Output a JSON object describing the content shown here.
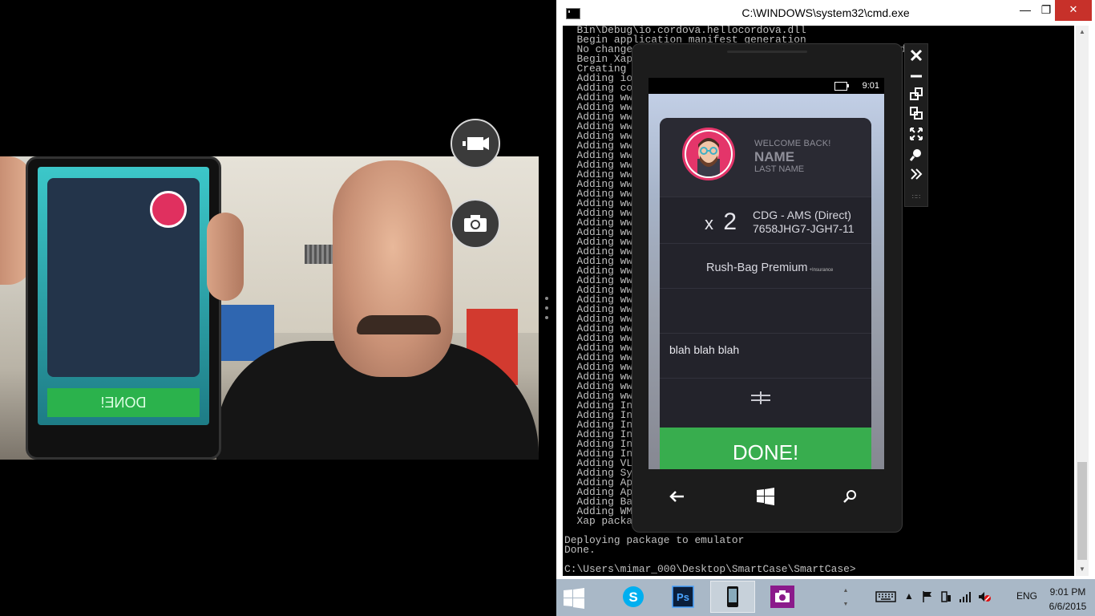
{
  "console": {
    "title": "C:\\WINDOWS\\system32\\cmd.exe",
    "minimize": "—",
    "maximize": "❐",
    "close": "✕",
    "lines": [
      "  Bin\\Debug\\io.cordova.hellocordova.dll",
      "  Begin application manifest generation",
      "  No change                                        to date",
      "  Begin Xap",
      "  Creating",
      "  Adding io",
      "  Adding co",
      "  Adding ww",
      "  Adding ww",
      "  Adding ww",
      "  Adding ww",
      "  Adding ww",
      "  Adding ww",
      "  Adding ww",
      "  Adding ww",
      "  Adding ww",
      "  Adding ww",
      "  Adding ww",
      "  Adding ww",
      "  Adding ww",
      "  Adding ww",
      "  Adding ww",
      "  Adding ww",
      "  Adding ww",
      "  Adding ww",
      "  Adding ww",
      "  Adding ww",
      "  Adding ww",
      "  Adding ww",
      "  Adding ww",
      "  Adding ww",
      "  Adding ww",
      "  Adding ww",
      "  Adding ww",
      "  Adding ww",
      "  Adding ww",
      "  Adding ww",
      "  Adding ww",
      "  Adding ww",
      "  Adding In",
      "  Adding In",
      "  Adding In",
      "  Adding In",
      "  Adding In",
      "  Adding In",
      "  Adding VL",
      "  Adding Sy",
      "  Adding Ap",
      "  Adding Ap",
      "  Adding Ba",
      "  Adding WM",
      "  Xap packa",
      "",
      "Deploying package to emulator",
      "Done.",
      "",
      "C:\\Users\\mimar_000\\Desktop\\SmartCase\\SmartCase>"
    ]
  },
  "camera": {
    "video_button": "video-mode",
    "photo_button": "photo-mode",
    "photo_phone_done": "DONE!"
  },
  "emulator": {
    "status_time": "9:01",
    "profile": {
      "welcome": "WELCOME BACK!",
      "name": "NAME",
      "last_name": "LAST NAME"
    },
    "bag": {
      "multiplier": "x",
      "count": "2",
      "route": "CDG - AMS (Direct)",
      "reference": "7658JHG7-JGH7-11"
    },
    "insurance": {
      "label": "Rush-Bag Premium",
      "suffix": "+Insurance"
    },
    "note": "blah blah blah",
    "done_label": "DONE!",
    "toolbar": [
      "close",
      "minimize",
      "rotate-left",
      "rotate-right",
      "fit-to-screen",
      "zoom",
      "tools"
    ]
  },
  "taskbar": {
    "apps": [
      "skype",
      "photoshop",
      "phone-emulator",
      "camera"
    ],
    "active_app": "phone-emulator",
    "language": "ENG",
    "time": "9:01 PM",
    "date": "6/6/2015"
  }
}
